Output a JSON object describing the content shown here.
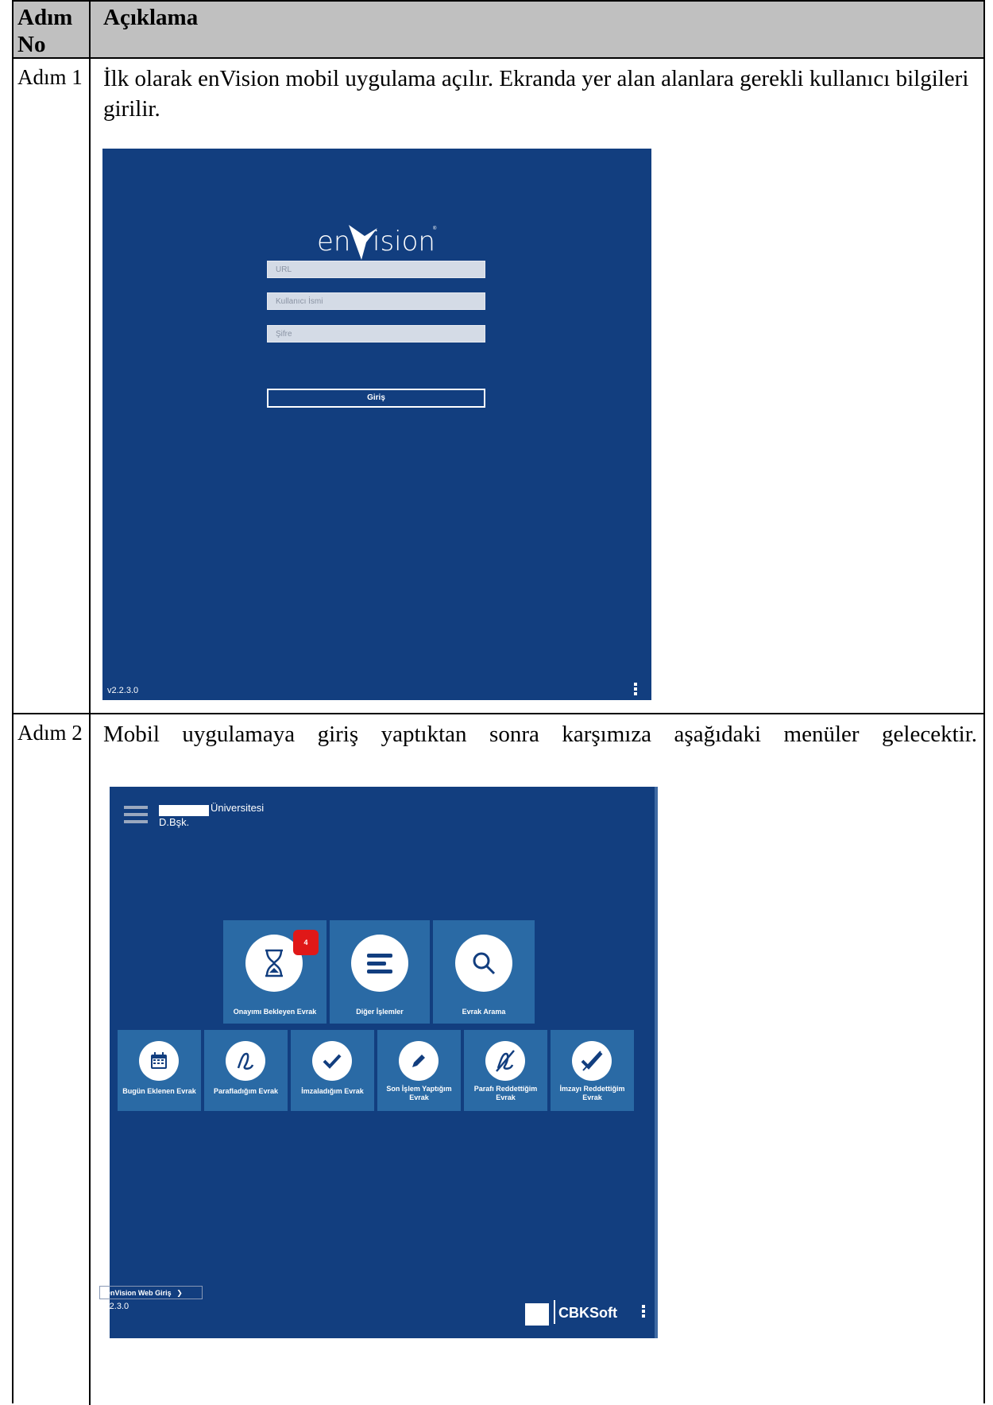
{
  "table": {
    "header": {
      "col1": "Adım No",
      "col2": "Açıklama"
    },
    "rows": [
      {
        "step": "Adım 1",
        "text": "İlk olarak enVision mobil uygulama açılır. Ekranda yer alan alanlara gerekli kullanıcı bilgileri girilir."
      },
      {
        "step": "Adım 2",
        "text": "Mobil uygulamaya giriş yaptıktan sonra karşımıza aşağıdaki menüler gelecektir."
      }
    ]
  },
  "login_screen": {
    "logo": "enVision",
    "url_placeholder": "URL",
    "username_placeholder": "Kullanıcı İsmi",
    "password_placeholder": "Şifre",
    "login_button": "Giriş",
    "version": "v2.2.3.0"
  },
  "home_screen": {
    "institution": "Üniversitesi",
    "department": "D.Bşk.",
    "badge_count": "4",
    "top_tiles": [
      {
        "label": "Onayımı Bekleyen Evrak",
        "icon": "hourglass-icon"
      },
      {
        "label": "Diğer İşlemler",
        "icon": "list-icon"
      },
      {
        "label": "Evrak Arama",
        "icon": "search-icon"
      }
    ],
    "bottom_tiles": [
      {
        "label": "Bugün Eklenen Evrak",
        "icon": "calendar-icon"
      },
      {
        "label": "Parafladığım Evrak",
        "icon": "paraf-icon"
      },
      {
        "label": "İmzaladığım Evrak",
        "icon": "check-icon"
      },
      {
        "label": "Son İşlem Yaptığım Evrak",
        "icon": "pencil-icon"
      },
      {
        "label": "Parafı Reddettiğim Evrak",
        "icon": "paraf-rejected-icon"
      },
      {
        "label": "İmzayı Reddettiğim Evrak",
        "icon": "check-rejected-icon"
      }
    ],
    "web_login": "enVision Web Giriş",
    "version": "v2.2.3.0",
    "brand": "CBKSoft"
  }
}
